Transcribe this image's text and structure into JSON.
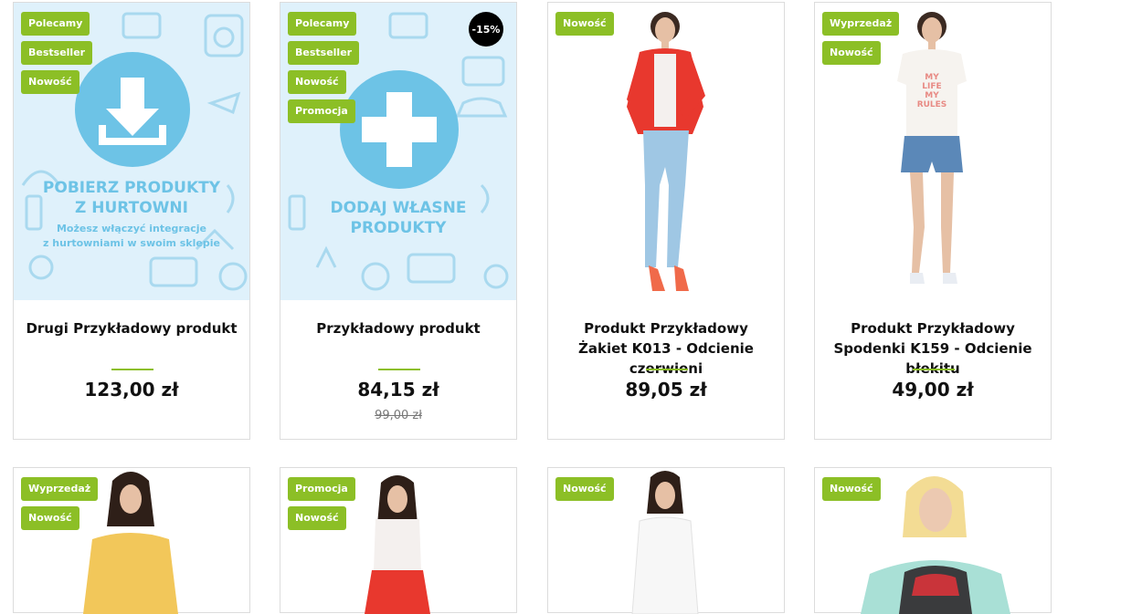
{
  "products": [
    {
      "labels": [
        "Polecamy",
        "Bestseller",
        "Nowość"
      ],
      "promo_title": "POBIERZ PRODUKTY\nZ HURTOWNI",
      "promo_sub": "Możesz włączyć integracje\nz hurtowniami w swoim sklepie",
      "name": "Drugi Przykładowy produkt",
      "price": "123,00 zł"
    },
    {
      "labels": [
        "Polecamy",
        "Bestseller",
        "Nowość",
        "Promocja"
      ],
      "discount": "-15%",
      "promo_title": "DODAJ WŁASNE\nPRODUKTY",
      "name": "Przykładowy produkt",
      "price": "84,15 zł",
      "old_price": "99,00 zł"
    },
    {
      "labels": [
        "Nowość"
      ],
      "name": "Produkt Przykładowy Żakiet K013 - Odcienie czerwieni",
      "price": "89,05 zł"
    },
    {
      "labels": [
        "Wyprzedaż",
        "Nowość"
      ],
      "shirt_text": "MY\nLIFE\nMY\nRULES",
      "name": "Produkt Przykładowy Spodenki K159 - Odcienie błekitu",
      "price": "49,00 zł"
    },
    {
      "labels": [
        "Wyprzedaż",
        "Nowość"
      ]
    },
    {
      "labels": [
        "Promocja",
        "Nowość"
      ]
    },
    {
      "labels": [
        "Nowość"
      ]
    },
    {
      "labels": [
        "Nowość"
      ]
    }
  ],
  "colors": {
    "label_green": "#8cbf26",
    "promo_blue": "#6dc3e6",
    "promo_bg": "#dff1fb"
  }
}
